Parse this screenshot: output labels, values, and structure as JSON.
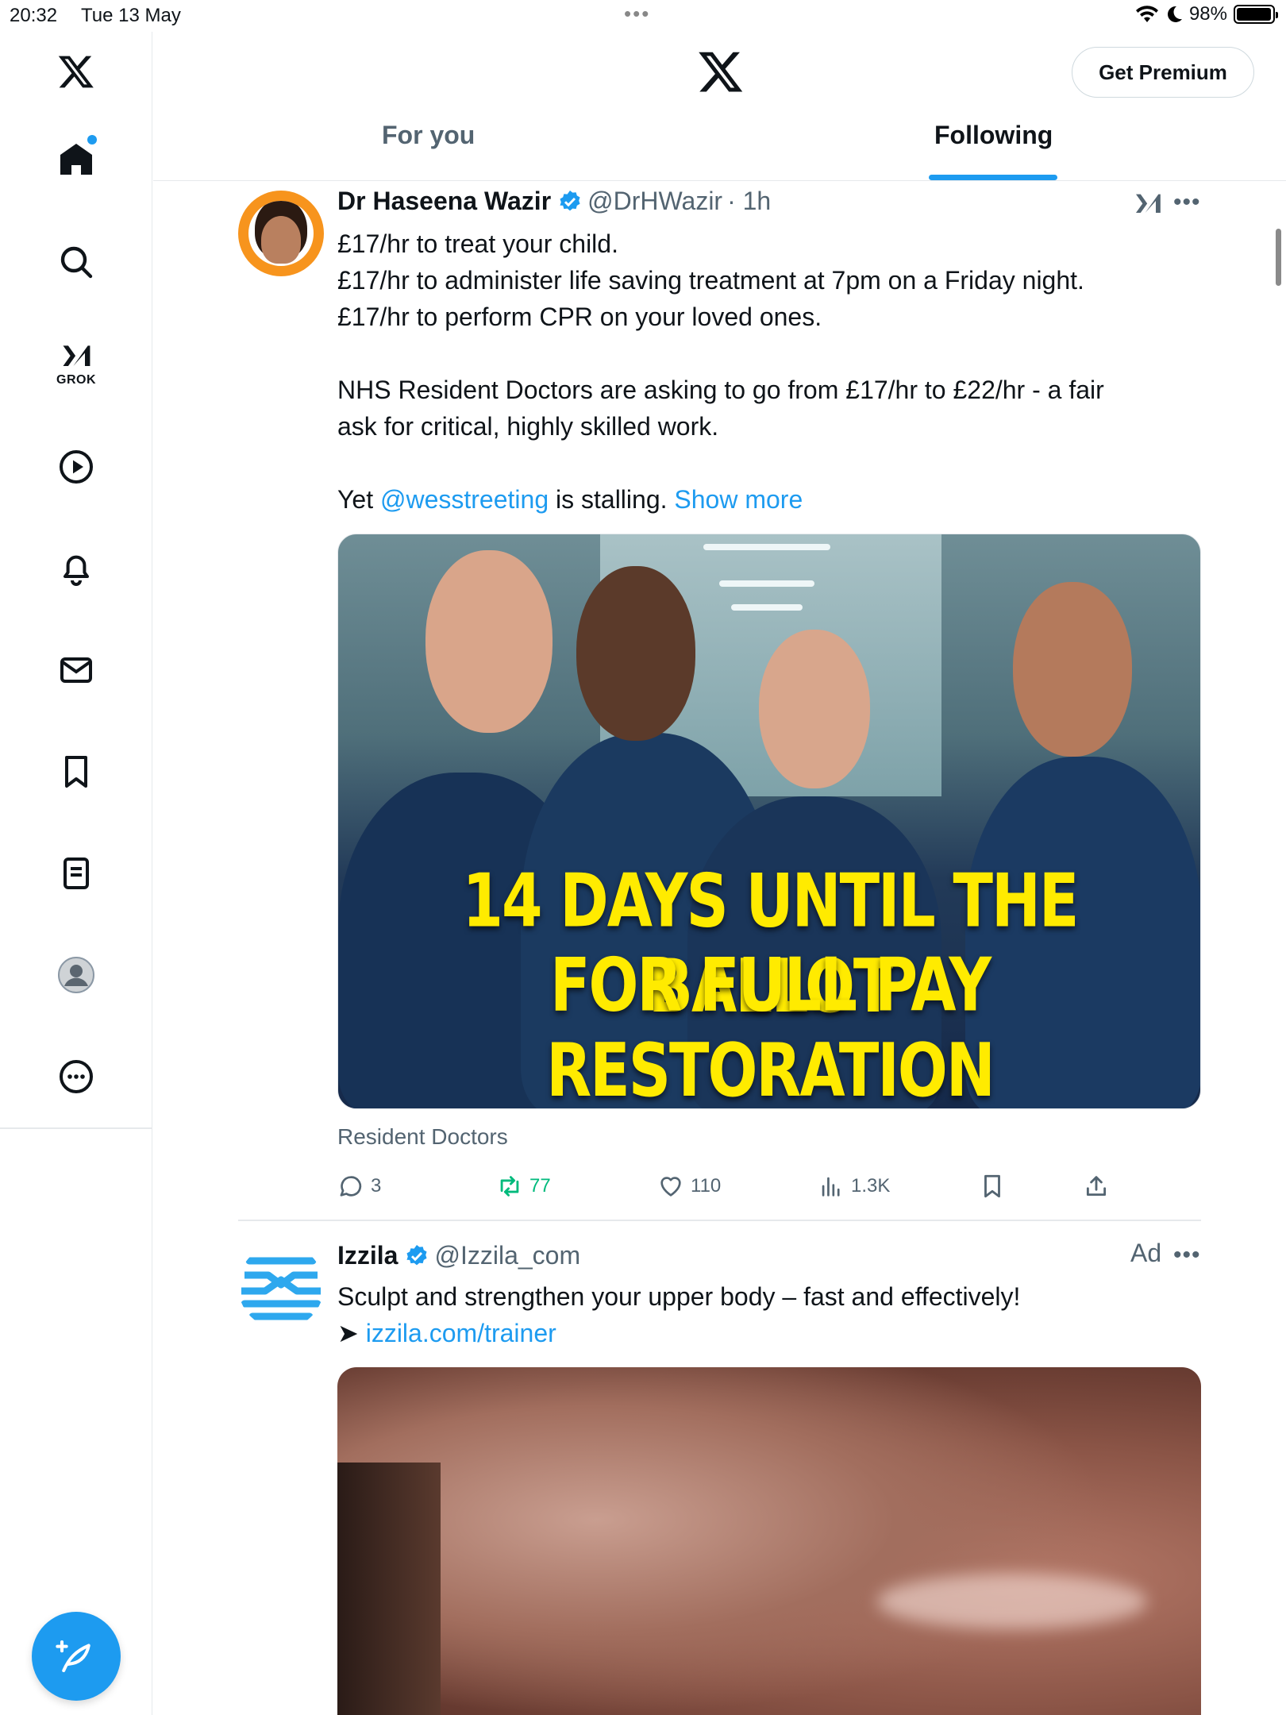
{
  "status_bar": {
    "time": "20:32",
    "date": "Tue 13 May",
    "battery": "98%",
    "battery_level": 0.98
  },
  "sidebar": {
    "grok_label": "GROK",
    "items": [
      "home-icon",
      "search-icon",
      "grok-icon",
      "video-icon",
      "notifications-icon",
      "messages-icon",
      "bookmarks-icon",
      "lists-icon",
      "profile-icon",
      "more-icon"
    ]
  },
  "header": {
    "premium_button": "Get Premium",
    "tabs": [
      {
        "label": "For you",
        "active": false
      },
      {
        "label": "Following",
        "active": true
      }
    ]
  },
  "tweets": [
    {
      "name": "Dr Haseena Wazir",
      "handle": "@DrHWazir",
      "time": "· 1h",
      "lines": [
        "£17/hr to treat your child.",
        "£17/hr to administer life saving treatment at 7pm on a Friday night.",
        "£17/hr to perform CPR on your loved ones.",
        "NHS Resident Doctors are asking to go from £17/hr to £22/hr - a fair",
        "ask for critical, highly skilled work."
      ],
      "last_line": {
        "prefix": "Yet",
        "mention": "@wesstreeting",
        "suffix": "is stalling.",
        "show_more": "Show more"
      },
      "media": {
        "line1": "14 DAYS UNTIL THE BALLOT",
        "line2": "FOR FULL PAY RESTORATION"
      },
      "media_caption": "Resident Doctors",
      "stats": {
        "replies": "3",
        "reposts": "77",
        "likes": "110",
        "views": "1.3K"
      }
    },
    {
      "name": "Izzila",
      "handle": "@Izzila_com",
      "ad_label": "Ad",
      "text": "Sculpt and strengthen your upper body – fast and effectively!",
      "link_arrow": "➤",
      "link": "izzila.com/trainer"
    }
  ],
  "colors": {
    "accent": "#1d9bf0",
    "repost_green": "#00ba7c",
    "banner_yellow": "#ffeb00",
    "avatar_ring": "#f7941d"
  }
}
